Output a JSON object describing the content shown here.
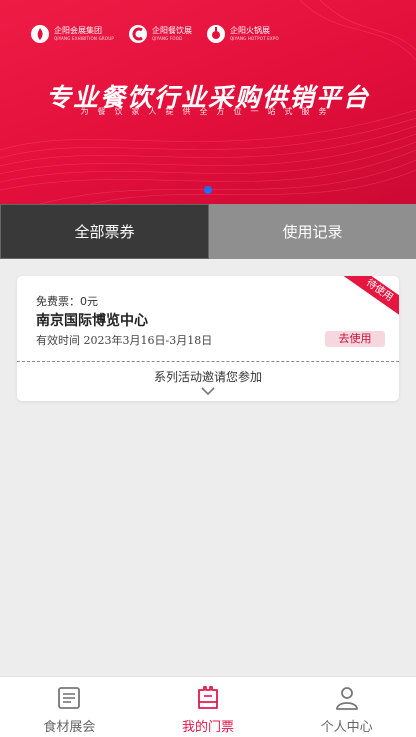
{
  "banner": {
    "logos": [
      {
        "name": "企阳会展集团",
        "sub": "QIYANG EXHIBITION GROUP"
      },
      {
        "name": "企阳餐饮展",
        "sub": "QIYANG FOOD"
      },
      {
        "name": "企阳火锅展",
        "sub": "QIYANG HOTPOT EXPO"
      }
    ],
    "headline": "专业餐饮行业采购供销平台",
    "subline": "为餐饮家人提供全方位一站式服务"
  },
  "tabs": [
    {
      "label": "全部票券",
      "active": true
    },
    {
      "label": "使用记录",
      "active": false
    }
  ],
  "ticket": {
    "ribbon": "待使用",
    "price": "免费票：0元",
    "venue": "南京国际博览中心",
    "valid": "有效时间 2023年3月16日-3月18日",
    "use_label": "去使用",
    "series": "系列活动邀请您参加"
  },
  "tabbar": [
    {
      "label": "食材展会",
      "icon": "news-icon",
      "active": false
    },
    {
      "label": "我的门票",
      "icon": "ticket-icon",
      "active": true
    },
    {
      "label": "个人中心",
      "icon": "person-icon",
      "active": false
    }
  ],
  "colors": {
    "brand_red": "#e20f3b",
    "accent_blue": "#1e6fff",
    "tab_active": "#393939",
    "tab_inactive": "#8f8f8f"
  }
}
